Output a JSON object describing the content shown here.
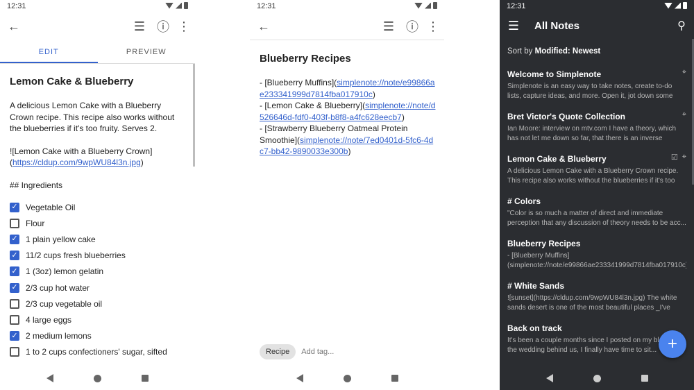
{
  "status_time": "12:31",
  "editor": {
    "tabs": [
      {
        "label": "EDIT"
      },
      {
        "label": "PREVIEW"
      }
    ],
    "title": "Lemon Cake & Blueberry",
    "description": "A delicious Lemon Cake with a Blueberry Crown recipe. This recipe also works without the blueberries if it's too fruity. Serves 2.",
    "image_md_prefix": "![Lemon Cake with a Blueberry Crown](",
    "image_url": "https://cldup.com/9wpWU84l3n.jpg",
    "image_md_suffix": ")",
    "heading": "## Ingredients",
    "checklist": [
      {
        "label": "Vegetable Oil",
        "checked": true
      },
      {
        "label": "Flour",
        "checked": false
      },
      {
        "label": "1 plain yellow cake",
        "checked": true
      },
      {
        "label": "11/2 cups fresh blueberries",
        "checked": true
      },
      {
        "label": "1 (3oz) lemon gelatin",
        "checked": true
      },
      {
        "label": "2/3 cup hot water",
        "checked": true
      },
      {
        "label": "2/3 cup vegetable oil",
        "checked": false
      },
      {
        "label": "4 large eggs",
        "checked": false
      },
      {
        "label": "2 medium lemons",
        "checked": true
      },
      {
        "label": "1 to 2 cups confectioners' sugar, sifted",
        "checked": false
      }
    ]
  },
  "preview": {
    "title": "Blueberry Recipes",
    "lines": [
      {
        "prefix": "- [Blueberry Muffins](",
        "link": "simplenote://note/e99866ae233341999d7814fba017910c",
        "suffix": ")"
      },
      {
        "prefix": "- [Lemon Cake & Blueberry](",
        "link": "simplenote://note/d526646d-fdf0-403f-b8f8-a4fc628eecb7",
        "suffix": ")"
      },
      {
        "prefix": "- [Strawberry Blueberry Oatmeal Protein Smoothie](",
        "link": "simplenote://note/7ed0401d-5fc6-4dc7-bb42-9890033e300b",
        "suffix": ")"
      }
    ],
    "tag": "Recipe",
    "tag_placeholder": "Add tag..."
  },
  "notes": {
    "title": "All Notes",
    "sort_prefix": "Sort by",
    "sort_value": "Modified: Newest",
    "items": [
      {
        "title": "Welcome to Simplenote",
        "preview": "Simplenote is an easy way to take notes, create to-do lists, capture ideas, and more. Open it, jot down some thoughts...",
        "pinned": true,
        "checklist": false
      },
      {
        "title": "Bret Victor's Quote Collection",
        "preview": "Ian Moore: interview on mtv.com I have a theory, which has not let me down so far, that there is an inverse relationship...",
        "pinned": true,
        "checklist": false
      },
      {
        "title": "Lemon Cake & Blueberry",
        "preview": "A delicious Lemon Cake with a Blueberry Crown recipe. This recipe also works without the blueberries if it's too fr...",
        "pinned": true,
        "checklist": true
      },
      {
        "title": "# Colors",
        "preview": "\"Color is so much a matter of direct and immediate perception that any discussion of theory needs to be acc...",
        "pinned": false,
        "checklist": false
      },
      {
        "title": "Blueberry Recipes",
        "preview": "- [Blueberry Muffins](simplenote://note/e99866ae233341999d7814fba017910c) - [Lemon Cake ...",
        "pinned": false,
        "checklist": false
      },
      {
        "title": "# White Sands",
        "preview": "![sunset](https://cldup.com/9wpWU84l3n.jpg) The white sands desert is one of the most beautiful places _I've eve...",
        "pinned": false,
        "checklist": false
      },
      {
        "title": "Back on track",
        "preview": "It's been a couple months since I posted on my blog with the wedding behind us, I finally have time to sit...",
        "pinned": false,
        "checklist": false
      }
    ]
  },
  "icons": {
    "pin": "pin-icon",
    "checklist": "checklist-icon",
    "menu": "menu-icon",
    "search": "search-icon",
    "info": "info-icon",
    "more": "more-vert-icon",
    "back": "arrow-back-icon",
    "add": "plus-icon"
  },
  "colors": {
    "accent": "#3361cc",
    "dark_bg": "#2b2d31",
    "fab": "#4a83ee"
  }
}
